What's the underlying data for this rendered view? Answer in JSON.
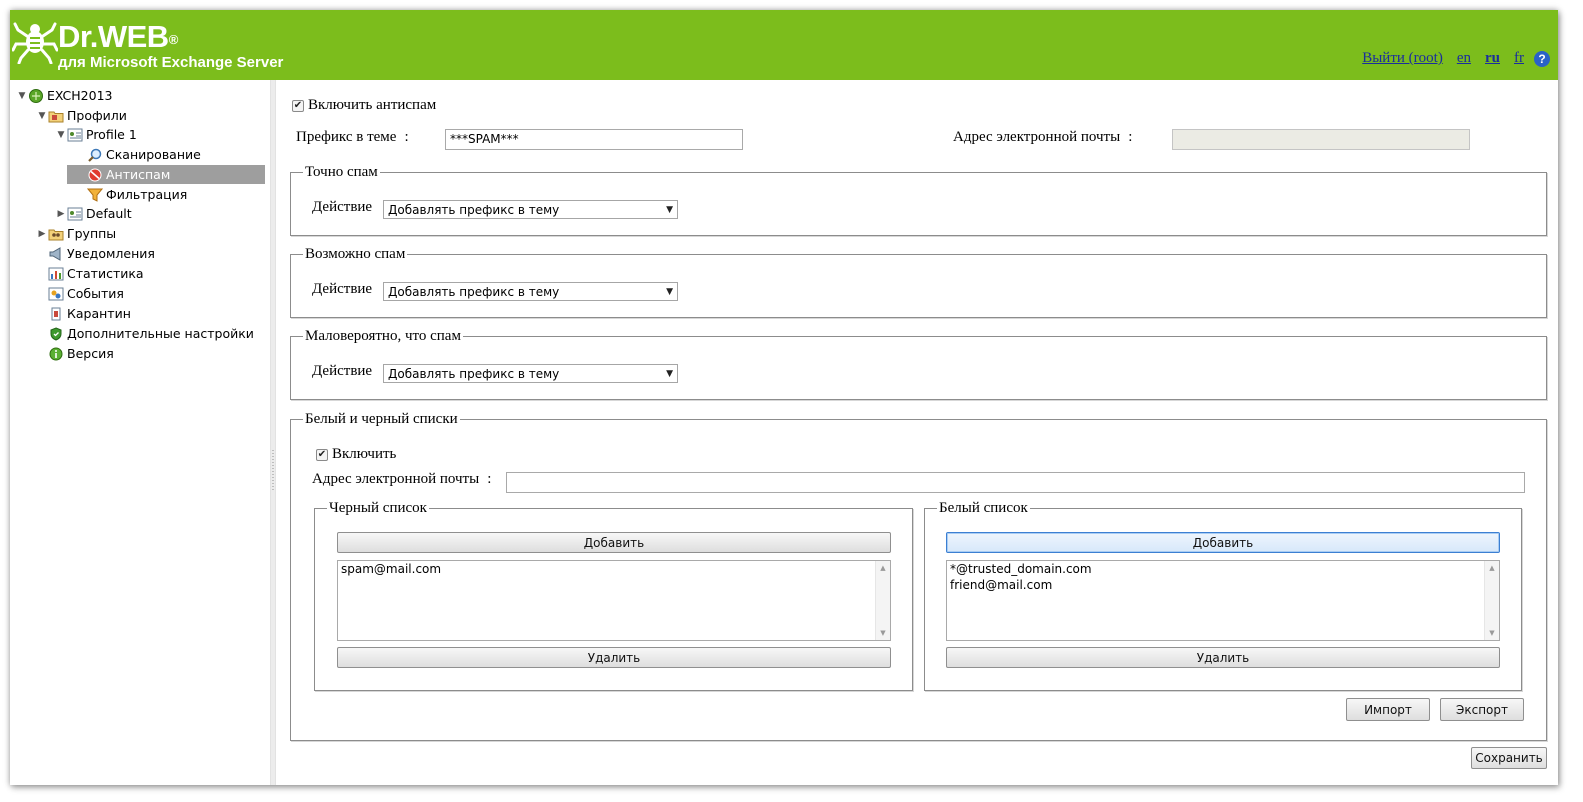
{
  "header": {
    "brand": "Dr.WEB",
    "brand_mark": "®",
    "subtitle": "для Microsoft Exchange Server",
    "bg_color": "#7cbd1c",
    "logout_link": "Выйти (root)",
    "languages": [
      "en",
      "ru",
      "fr"
    ],
    "current_language": "ru",
    "help_symbol": "?"
  },
  "sidebar": {
    "items": [
      {
        "label": "EXCH2013",
        "icon": "server-icon",
        "expanded": true
      },
      {
        "label": "Профили",
        "icon": "folder-icon",
        "expanded": true
      },
      {
        "label": "Profile 1",
        "icon": "profile-icon",
        "expanded": true
      },
      {
        "label": "Сканирование",
        "icon": "magnifier-icon"
      },
      {
        "label": "Антиспам",
        "icon": "antispam-icon",
        "selected": true
      },
      {
        "label": "Фильтрация",
        "icon": "filter-funnel-icon"
      },
      {
        "label": "Default",
        "icon": "profile-icon",
        "expanded": false
      },
      {
        "label": "Группы",
        "icon": "groups-icon",
        "expanded": false
      },
      {
        "label": "Уведомления",
        "icon": "megaphone-icon"
      },
      {
        "label": "Статистика",
        "icon": "bar-chart-icon"
      },
      {
        "label": "События",
        "icon": "events-icon"
      },
      {
        "label": "Карантин",
        "icon": "quarantine-icon"
      },
      {
        "label": "Дополнительные настройки",
        "icon": "shield-settings-icon"
      },
      {
        "label": "Версия",
        "icon": "info-icon"
      }
    ]
  },
  "antispam": {
    "enable_label": "Включить антиспам",
    "enable_checked": true,
    "prefix_label": "Префикс в теме",
    "prefix_value": "***SPAM***",
    "email_label": "Адрес электронной почты",
    "email_value": "",
    "colon": ":",
    "groups": [
      {
        "legend": "Точно спам",
        "action_label": "Действие",
        "action_value": "Добавлять префикс в тему"
      },
      {
        "legend": "Возможно спам",
        "action_label": "Действие",
        "action_value": "Добавлять префикс в тему"
      },
      {
        "legend": "Маловероятно, что спам",
        "action_label": "Действие",
        "action_value": "Добавлять префикс в тему"
      }
    ]
  },
  "lists": {
    "legend": "Белый и черный списки",
    "enable_label": "Включить",
    "enable_checked": true,
    "email_label": "Адрес электронной почты",
    "email_value": "",
    "blacklist": {
      "legend": "Черный список",
      "add_label": "Добавить",
      "remove_label": "Удалить",
      "items": [
        "spam@mail.com"
      ]
    },
    "whitelist": {
      "legend": "Белый список",
      "add_label": "Добавить",
      "remove_label": "Удалить",
      "items": [
        "*@trusted_domain.com",
        "friend@mail.com"
      ]
    },
    "import_label": "Импорт",
    "export_label": "Экспорт"
  },
  "save_label": "Сохранить"
}
